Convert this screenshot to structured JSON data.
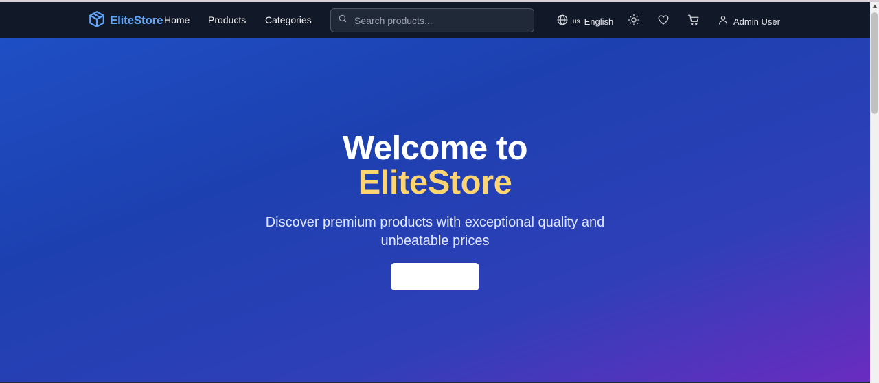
{
  "navbar": {
    "brand": "EliteStore",
    "links": [
      "Home",
      "Products",
      "Categories"
    ],
    "search_placeholder": "Search products...",
    "language": {
      "code": "us",
      "name": "English"
    },
    "user_name": "Admin User"
  },
  "hero": {
    "title_line1": "Welcome to",
    "title_line2": "EliteStore",
    "subtitle": "Discover premium products with exceptional quality and unbeatable prices",
    "cta_label": ""
  },
  "colors": {
    "navbar_bg": "#111827",
    "brand": "#60a5fa",
    "accent": "#fcd571",
    "hero_start": "#1e4fc4",
    "hero_end": "#6a2cc0"
  },
  "icons": [
    "box-logo-icon",
    "search-icon",
    "globe-icon",
    "sun-icon",
    "heart-icon",
    "cart-icon",
    "user-icon"
  ]
}
